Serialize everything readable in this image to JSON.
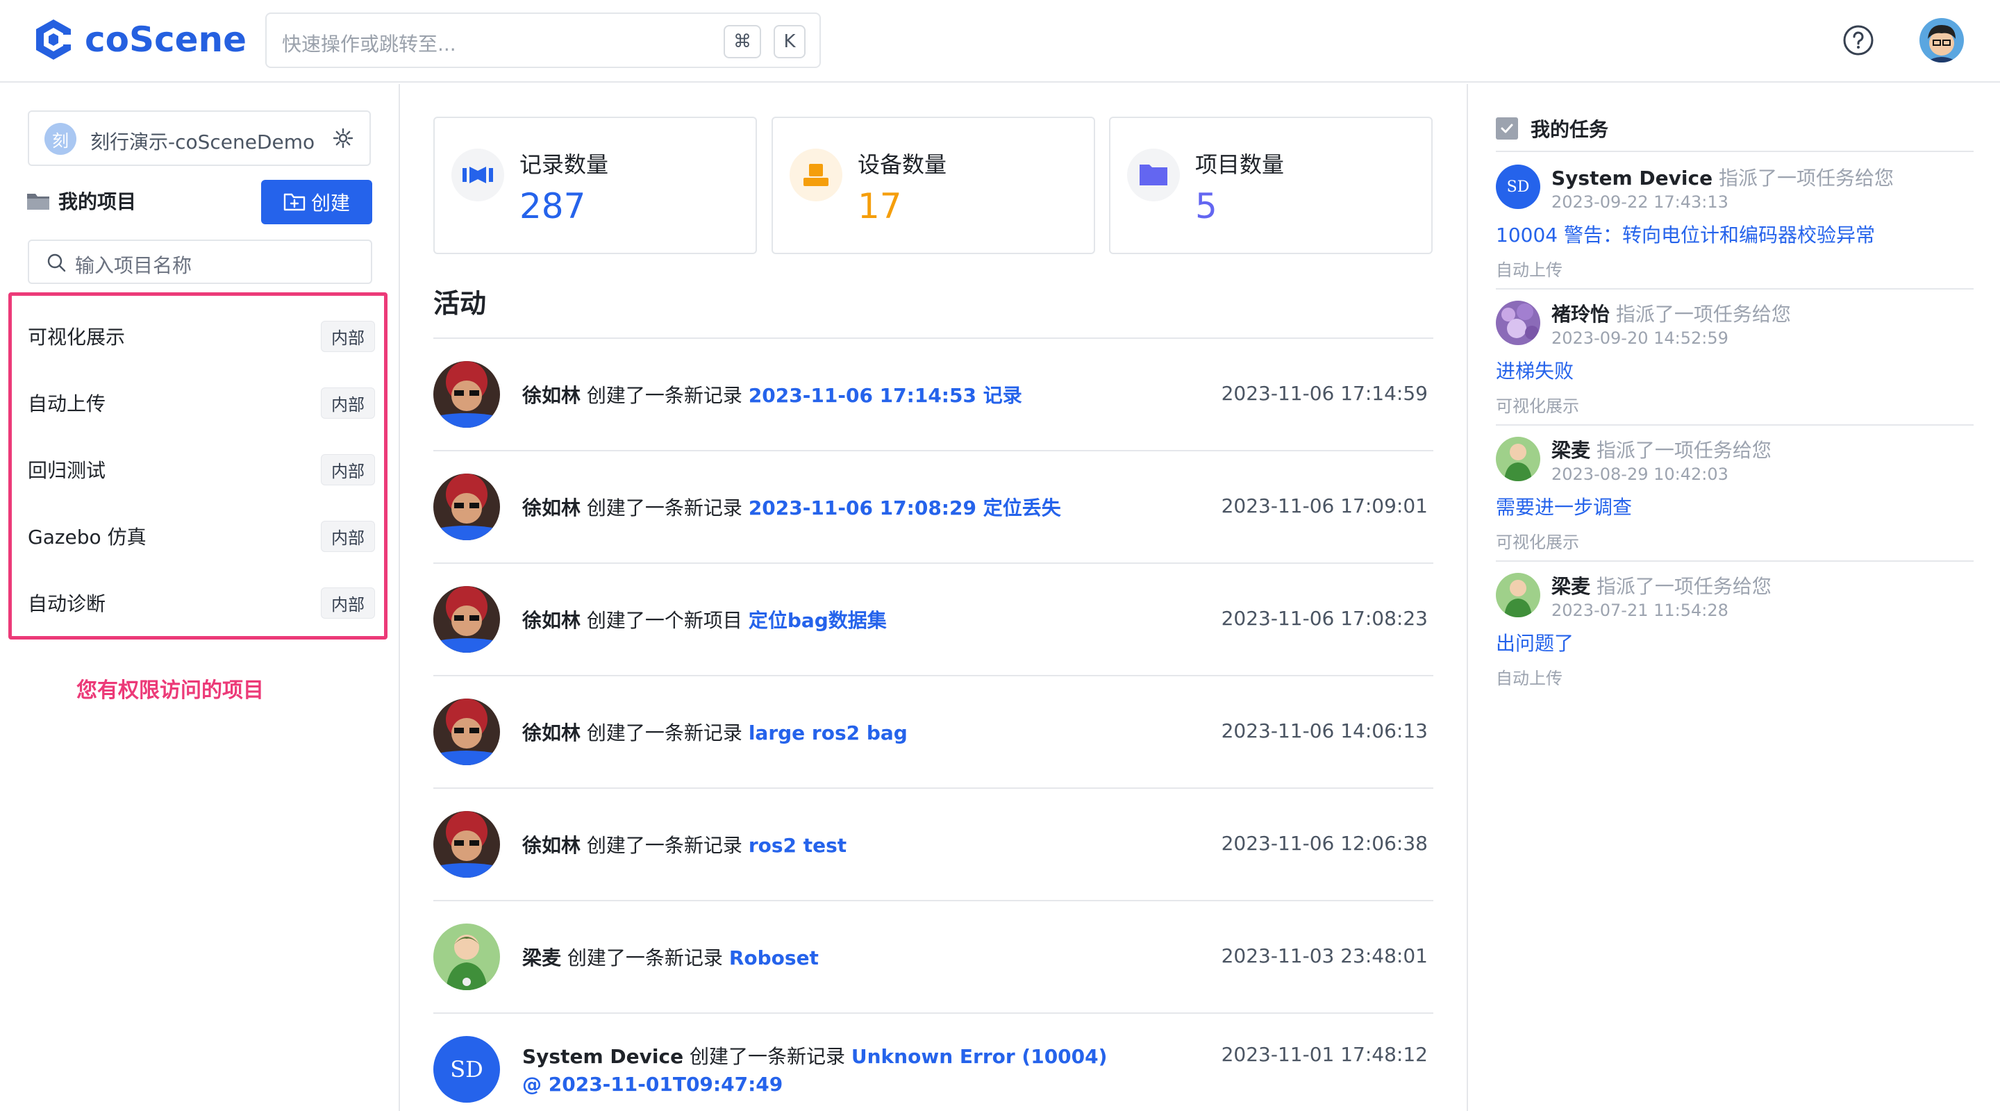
{
  "header": {
    "logo_text": "coScene",
    "search_placeholder": "快速操作或跳转至...",
    "shortcut_cmd": "⌘",
    "shortcut_key": "K"
  },
  "sidebar": {
    "org_badge": "刻",
    "org_name": "刻行演示-coSceneDemo",
    "my_projects_label": "我的项目",
    "create_label": "创建",
    "search_placeholder": "输入项目名称",
    "projects": [
      {
        "name": "可视化展示",
        "tag": "内部"
      },
      {
        "name": "自动上传",
        "tag": "内部"
      },
      {
        "name": "回归测试",
        "tag": "内部"
      },
      {
        "name": "Gazebo 仿真",
        "tag": "内部"
      },
      {
        "name": "自动诊断",
        "tag": "内部"
      }
    ],
    "annotation": "您有权限访问的项目"
  },
  "stats": [
    {
      "label": "记录数量",
      "value": "287",
      "color": "#2563eb",
      "icon": "records-icon"
    },
    {
      "label": "设备数量",
      "value": "17",
      "color": "#f59e0b",
      "icon": "device-icon"
    },
    {
      "label": "项目数量",
      "value": "5",
      "color": "#6366f1",
      "icon": "project-folder-icon"
    }
  ],
  "activity": {
    "title": "活动",
    "items": [
      {
        "user": "徐如林",
        "action": " 创建了一条新记录 ",
        "link": "2023-11-06 17:14:53 记录",
        "time": "2023-11-06 17:14:59"
      },
      {
        "user": "徐如林",
        "action": " 创建了一条新记录 ",
        "link": "2023-11-06 17:08:29 定位丢失",
        "time": "2023-11-06 17:09:01"
      },
      {
        "user": "徐如林",
        "action": " 创建了一个新项目 ",
        "link": "定位bag数据集",
        "time": "2023-11-06 17:08:23"
      },
      {
        "user": "徐如林",
        "action": " 创建了一条新记录 ",
        "link": "large ros2 bag",
        "time": "2023-11-06 14:06:13"
      },
      {
        "user": "徐如林",
        "action": " 创建了一条新记录 ",
        "link": "ros2 test",
        "time": "2023-11-06 12:06:38"
      },
      {
        "user": "梁麦",
        "action": " 创建了一条新记录 ",
        "link": "Roboset",
        "time": "2023-11-03 23:48:01"
      },
      {
        "user": "System Device",
        "action": " 创建了一条新记录 ",
        "link": "Unknown Error (10004) @ 2023-11-01T09:47:49",
        "time": "2023-11-01 17:48:12",
        "avatar_text": "SD"
      }
    ]
  },
  "tasks": {
    "title": "我的任务",
    "items": [
      {
        "user": "System Device",
        "action": " 指派了一项任务给您",
        "time": "2023-09-22 17:43:13",
        "title": "10004 警告：转向电位计和编码器校验异常",
        "project": "自动上传",
        "avatar_text": "SD"
      },
      {
        "user": "褚玲怡",
        "action": " 指派了一项任务给您",
        "time": "2023-09-20 14:52:59",
        "title": "进梯失败",
        "project": "可视化展示"
      },
      {
        "user": "梁麦",
        "action": " 指派了一项任务给您",
        "time": "2023-08-29 10:42:03",
        "title": "需要进一步调查",
        "project": "可视化展示"
      },
      {
        "user": "梁麦",
        "action": " 指派了一项任务给您",
        "time": "2023-07-21 11:54:28",
        "title": "出问题了",
        "project": "自动上传"
      }
    ]
  }
}
